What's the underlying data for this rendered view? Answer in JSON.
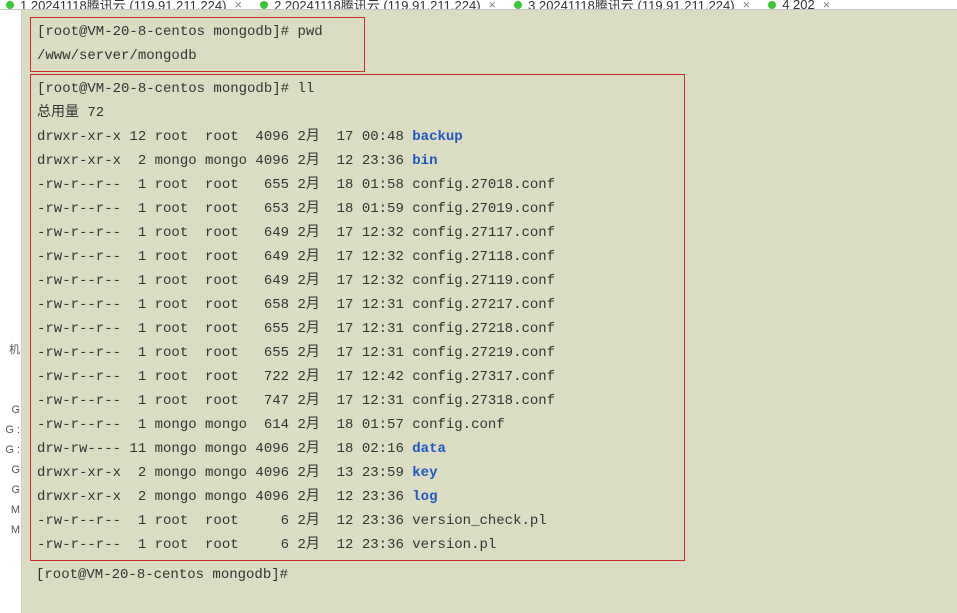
{
  "tabs": [
    {
      "label": "1 20241118腾讯云 (119.91.211.224)"
    },
    {
      "label": "2 20241118腾讯云 (119.91.211.224)"
    },
    {
      "label": "3 20241118腾讯云 (119.91.211.224)"
    },
    {
      "label": "4 202"
    }
  ],
  "leftFragments": "机\n\n\nG\nG :\nG :\nG\nG\nM\nM",
  "pwd": {
    "prompt": "[root@VM-20-8-centos mongodb]# ",
    "cmd": "pwd",
    "output": "/www/server/mongodb"
  },
  "ll": {
    "prompt": "[root@VM-20-8-centos mongodb]# ",
    "cmd": "ll",
    "total": "总用量 72",
    "rows": [
      {
        "perm": "drwxr-xr-x",
        "lnk": "12",
        "own": "root ",
        "grp": "root ",
        "sz": "4096",
        "mon": "2月",
        "day": "17",
        "time": "00:48",
        "name": "backup",
        "dir": true
      },
      {
        "perm": "drwxr-xr-x",
        "lnk": " 2",
        "own": "mongo",
        "grp": "mongo",
        "sz": "4096",
        "mon": "2月",
        "day": "12",
        "time": "23:36",
        "name": "bin",
        "dir": true
      },
      {
        "perm": "-rw-r--r--",
        "lnk": " 1",
        "own": "root ",
        "grp": "root ",
        "sz": " 655",
        "mon": "2月",
        "day": "18",
        "time": "01:58",
        "name": "config.27018.conf",
        "dir": false
      },
      {
        "perm": "-rw-r--r--",
        "lnk": " 1",
        "own": "root ",
        "grp": "root ",
        "sz": " 653",
        "mon": "2月",
        "day": "18",
        "time": "01:59",
        "name": "config.27019.conf",
        "dir": false
      },
      {
        "perm": "-rw-r--r--",
        "lnk": " 1",
        "own": "root ",
        "grp": "root ",
        "sz": " 649",
        "mon": "2月",
        "day": "17",
        "time": "12:32",
        "name": "config.27117.conf",
        "dir": false
      },
      {
        "perm": "-rw-r--r--",
        "lnk": " 1",
        "own": "root ",
        "grp": "root ",
        "sz": " 649",
        "mon": "2月",
        "day": "17",
        "time": "12:32",
        "name": "config.27118.conf",
        "dir": false
      },
      {
        "perm": "-rw-r--r--",
        "lnk": " 1",
        "own": "root ",
        "grp": "root ",
        "sz": " 649",
        "mon": "2月",
        "day": "17",
        "time": "12:32",
        "name": "config.27119.conf",
        "dir": false
      },
      {
        "perm": "-rw-r--r--",
        "lnk": " 1",
        "own": "root ",
        "grp": "root ",
        "sz": " 658",
        "mon": "2月",
        "day": "17",
        "time": "12:31",
        "name": "config.27217.conf",
        "dir": false
      },
      {
        "perm": "-rw-r--r--",
        "lnk": " 1",
        "own": "root ",
        "grp": "root ",
        "sz": " 655",
        "mon": "2月",
        "day": "17",
        "time": "12:31",
        "name": "config.27218.conf",
        "dir": false
      },
      {
        "perm": "-rw-r--r--",
        "lnk": " 1",
        "own": "root ",
        "grp": "root ",
        "sz": " 655",
        "mon": "2月",
        "day": "17",
        "time": "12:31",
        "name": "config.27219.conf",
        "dir": false
      },
      {
        "perm": "-rw-r--r--",
        "lnk": " 1",
        "own": "root ",
        "grp": "root ",
        "sz": " 722",
        "mon": "2月",
        "day": "17",
        "time": "12:42",
        "name": "config.27317.conf",
        "dir": false
      },
      {
        "perm": "-rw-r--r--",
        "lnk": " 1",
        "own": "root ",
        "grp": "root ",
        "sz": " 747",
        "mon": "2月",
        "day": "17",
        "time": "12:31",
        "name": "config.27318.conf",
        "dir": false
      },
      {
        "perm": "-rw-r--r--",
        "lnk": " 1",
        "own": "mongo",
        "grp": "mongo",
        "sz": " 614",
        "mon": "2月",
        "day": "18",
        "time": "01:57",
        "name": "config.conf",
        "dir": false
      },
      {
        "perm": "drw-rw----",
        "lnk": "11",
        "own": "mongo",
        "grp": "mongo",
        "sz": "4096",
        "mon": "2月",
        "day": "18",
        "time": "02:16",
        "name": "data",
        "dir": true
      },
      {
        "perm": "drwxr-xr-x",
        "lnk": " 2",
        "own": "mongo",
        "grp": "mongo",
        "sz": "4096",
        "mon": "2月",
        "day": "13",
        "time": "23:59",
        "name": "key",
        "dir": true
      },
      {
        "perm": "drwxr-xr-x",
        "lnk": " 2",
        "own": "mongo",
        "grp": "mongo",
        "sz": "4096",
        "mon": "2月",
        "day": "12",
        "time": "23:36",
        "name": "log",
        "dir": true
      },
      {
        "perm": "-rw-r--r--",
        "lnk": " 1",
        "own": "root ",
        "grp": "root ",
        "sz": "   6",
        "mon": "2月",
        "day": "12",
        "time": "23:36",
        "name": "version_check.pl",
        "dir": false
      },
      {
        "perm": "-rw-r--r--",
        "lnk": " 1",
        "own": "root ",
        "grp": "root ",
        "sz": "   6",
        "mon": "2月",
        "day": "12",
        "time": "23:36",
        "name": "version.pl",
        "dir": false
      }
    ]
  },
  "afterPrompt": "[root@VM-20-8-centos mongodb]#"
}
